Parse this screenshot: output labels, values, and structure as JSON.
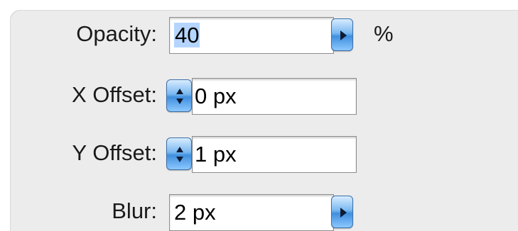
{
  "form": {
    "opacity": {
      "label": "Opacity:",
      "value": "40",
      "unit": "%"
    },
    "x_offset": {
      "label": "X Offset:",
      "value": "0 px"
    },
    "y_offset": {
      "label": "Y Offset:",
      "value": "1 px"
    },
    "blur": {
      "label": "Blur:",
      "value": "2 px"
    }
  },
  "icons": {
    "dropdown": "triangle-right-icon",
    "stepper": "up-down-stepper-icon"
  },
  "colors": {
    "panel_bg": "#ececec",
    "selection": "#b5d5ff",
    "aqua_button": "#3f8fde"
  }
}
